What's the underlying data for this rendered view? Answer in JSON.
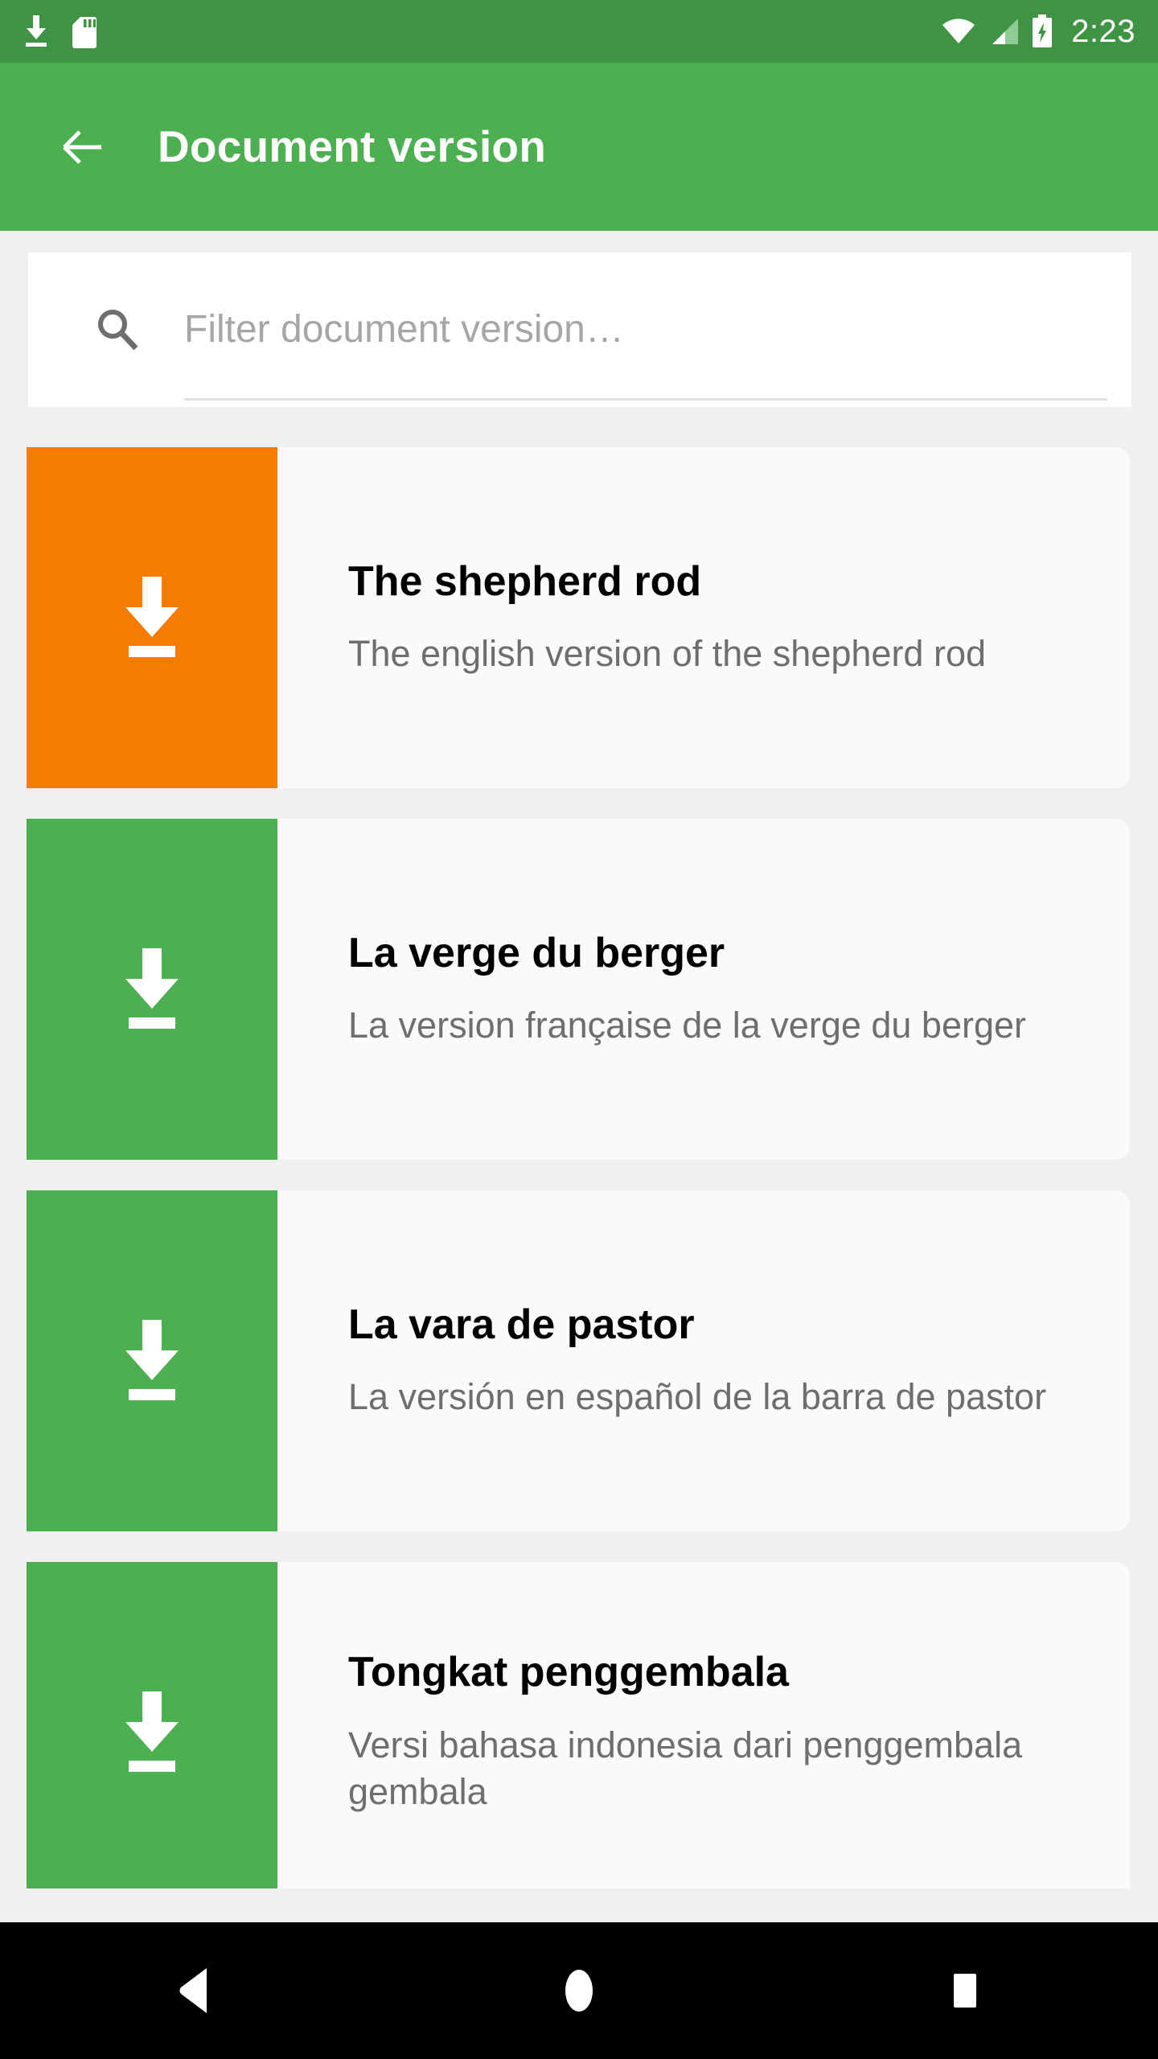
{
  "status_bar": {
    "background_color": "#3E9443",
    "time": "2:23",
    "left_icons": [
      {
        "name": "download-status-icon",
        "label": "download"
      },
      {
        "name": "sd-card-icon",
        "label": "sd card"
      }
    ],
    "right_icons": [
      {
        "name": "wifi-icon",
        "label": "wifi full"
      },
      {
        "name": "cellular-signal-icon",
        "label": "signal 2 of 4 bars"
      },
      {
        "name": "battery-charging-icon",
        "label": "battery charging"
      }
    ]
  },
  "app_bar": {
    "background_color": "#4CAF50",
    "title": "Document version",
    "back_label": "Back"
  },
  "search": {
    "placeholder": "Filter document version…",
    "value": "",
    "icon": "search-icon"
  },
  "documents": [
    {
      "title": "The shepherd rod",
      "subtitle": "The english version of the shepherd rod",
      "tile_color": "#F57C00",
      "icon": "download-icon"
    },
    {
      "title": "La verge du berger",
      "subtitle": "La version française de la verge du berger",
      "tile_color": "#4CAF50",
      "icon": "download-icon"
    },
    {
      "title": "La vara de pastor",
      "subtitle": "La versión en español de la barra de pastor",
      "tile_color": "#4CAF50",
      "icon": "download-icon"
    },
    {
      "title": "Tongkat penggembala",
      "subtitle": "Versi bahasa indonesia dari penggembala gembala",
      "tile_color": "#4CAF50",
      "icon": "download-icon"
    }
  ],
  "nav_bar": {
    "background_color": "#000000",
    "buttons": [
      {
        "name": "nav-back-button",
        "label": "Back"
      },
      {
        "name": "nav-home-button",
        "label": "Home"
      },
      {
        "name": "nav-recents-button",
        "label": "Recents"
      }
    ]
  }
}
